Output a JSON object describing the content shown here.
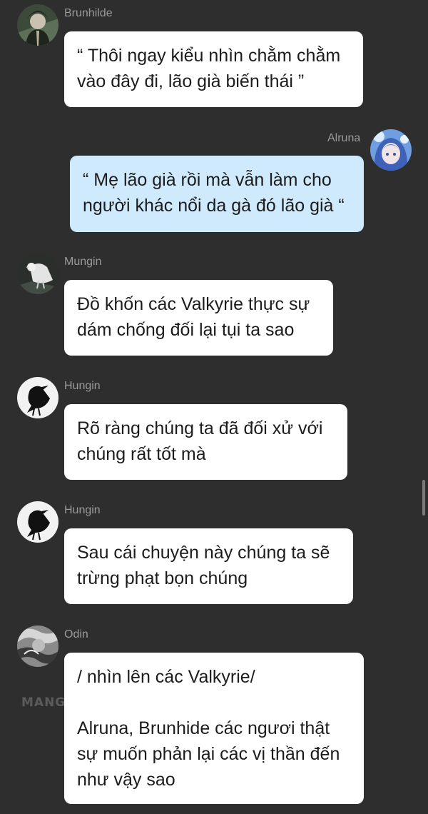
{
  "messages": [
    {
      "sender": "Brunhilde",
      "lines": [
        "“ Thôi ngay kiểu nhìn chằm chằm",
        "vào đây đi, lão già biến thái ”"
      ]
    },
    {
      "sender": "Alruna",
      "lines": [
        "“ Mẹ lão già rồi mà vẫn làm cho",
        "người khác nổi da gà đó lão già “"
      ]
    },
    {
      "sender": "Mungin",
      "lines": [
        "Đồ khốn các Valkyrie thực sự",
        "dám chống đối lại tụi ta sao"
      ]
    },
    {
      "sender": "Hungin",
      "lines": [
        "Rõ ràng chúng ta đã đối xử với",
        "chúng rất tốt mà"
      ]
    },
    {
      "sender": "Hungin",
      "lines": [
        "Sau cái chuyện này chúng ta sẽ",
        "trừng phạt bọn chúng"
      ]
    },
    {
      "sender": "Odin",
      "lines": [
        "/ nhìn lên các Valkyrie/",
        "",
        "Alruna, Brunhide các ngươi thật",
        "sự muốn phản lại các vị thần đến",
        "như vậy sao"
      ]
    }
  ],
  "watermark": "MANGA TOON",
  "colors": {
    "background": "#2e2e2e",
    "bubble_other": "#ffffff",
    "bubble_mine": "#cfeafc",
    "name_text": "#9a9a9a"
  },
  "icons": [
    "brunhilde-avatar-icon",
    "alruna-avatar-icon",
    "mungin-avatar-icon",
    "hungin-avatar-icon",
    "odin-avatar-icon"
  ]
}
